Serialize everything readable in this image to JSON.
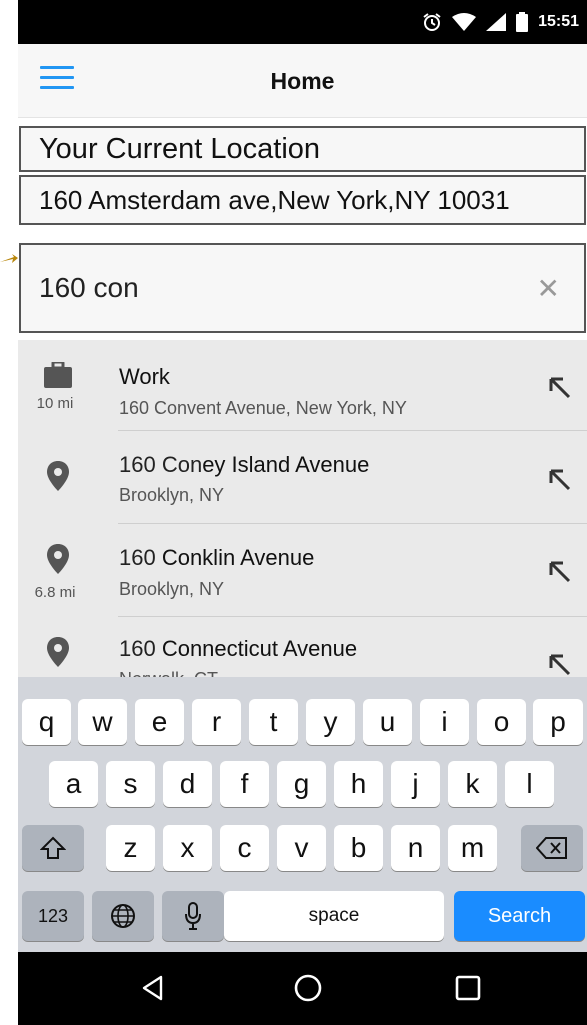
{
  "status_bar": {
    "time": "15:51",
    "icons": [
      "alarm-icon",
      "wifi-icon",
      "signal-icon",
      "battery-icon"
    ]
  },
  "app_bar": {
    "title": "Home",
    "menu_icon": "hamburger-menu-icon",
    "accent_color": "#2196f3"
  },
  "current_location": {
    "label": "Your Current Location",
    "address": "160 Amsterdam ave,New York,NY 10031"
  },
  "search": {
    "value": "160 con",
    "clear_icon": "close-icon"
  },
  "suggestions": [
    {
      "icon": "briefcase-icon",
      "distance": "10 mi",
      "title_plain": "",
      "title_bold": "Work",
      "subtitle": "160 Convent Avenue, New York, NY"
    },
    {
      "icon": "location-pin-icon",
      "distance": "",
      "title_plain": "160 Con",
      "title_bold": "ey Island Avenue",
      "subtitle": "Brooklyn, NY"
    },
    {
      "icon": "location-pin-icon",
      "distance": "6.8 mi",
      "title_plain": "160 ",
      "title_bold": "Conklin Avenue",
      "subtitle": "Brooklyn, NY"
    },
    {
      "icon": "location-pin-icon",
      "distance": "",
      "title_plain": "160 ",
      "title_bold": "Connecticut Avenue",
      "subtitle": "Norwalk, CT"
    }
  ],
  "keyboard": {
    "row1": [
      "q",
      "w",
      "e",
      "r",
      "t",
      "y",
      "u",
      "i",
      "o",
      "p"
    ],
    "row2": [
      "a",
      "s",
      "d",
      "f",
      "g",
      "h",
      "j",
      "k",
      "l"
    ],
    "row3": [
      "z",
      "x",
      "c",
      "v",
      "b",
      "n",
      "m"
    ],
    "numbers_label": "123",
    "space_label": "space",
    "search_label": "Search",
    "search_color": "#1a8cff"
  },
  "nav_bar": {
    "icons": [
      "back-triangle-icon",
      "home-circle-icon",
      "recents-square-icon"
    ]
  }
}
